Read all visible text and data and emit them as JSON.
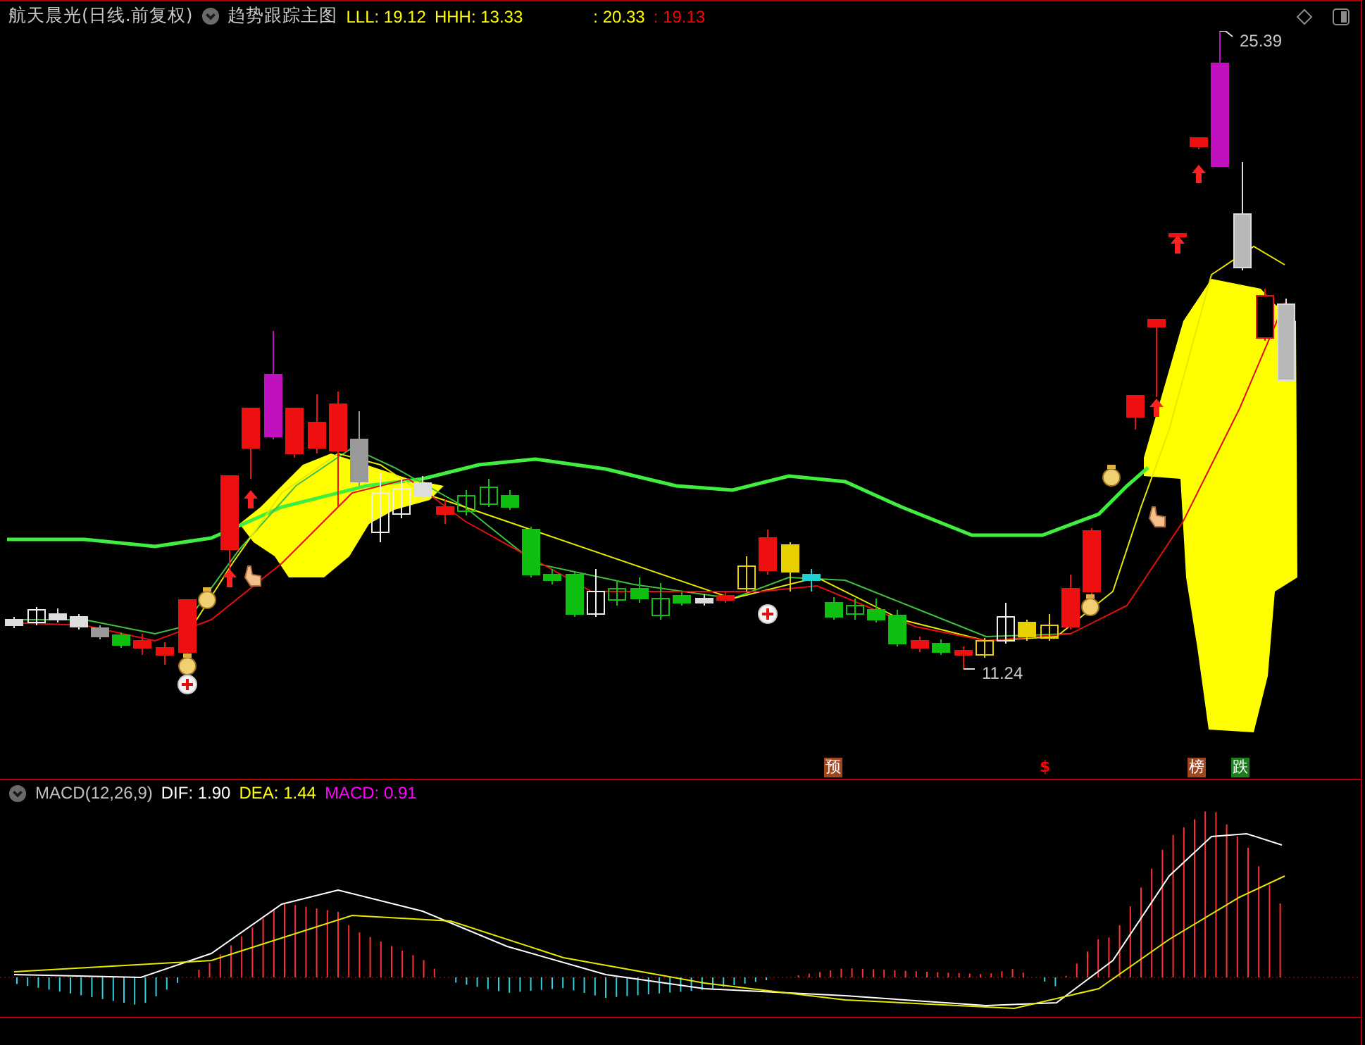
{
  "header": {
    "title": "航天晨光(日线.前复权)",
    "indicator": "趋势跟踪主图",
    "values": [
      {
        "text": "LLL: 19.12",
        "color": "#ffff00"
      },
      {
        "text": "HHH: 13.33",
        "color": "#ffff00"
      },
      {
        "text": ": 20.33",
        "color": "#ffff00"
      },
      {
        "text": ": 19.13",
        "color": "#ff0000"
      }
    ]
  },
  "price_labels": [
    {
      "kind": "high",
      "text": "25.39"
    },
    {
      "kind": "low",
      "text": "11.24"
    }
  ],
  "signals": [
    {
      "kind": "badge",
      "text": "预",
      "color": "#a0461e"
    },
    {
      "kind": "plain",
      "text": "$",
      "color": "#ff0000"
    },
    {
      "kind": "badge",
      "text": "榜",
      "color": "#a0461e"
    },
    {
      "kind": "badge",
      "text": "跌",
      "color": "#1e7d1e"
    }
  ],
  "macd": {
    "title": "MACD(12,26,9)",
    "values": [
      {
        "text": "DIF: 1.90",
        "color": "#ffffff"
      },
      {
        "text": "DEA: 1.44",
        "color": "#ffff00"
      },
      {
        "text": "MACD: 0.91",
        "color": "#ff00ff"
      }
    ]
  }
}
